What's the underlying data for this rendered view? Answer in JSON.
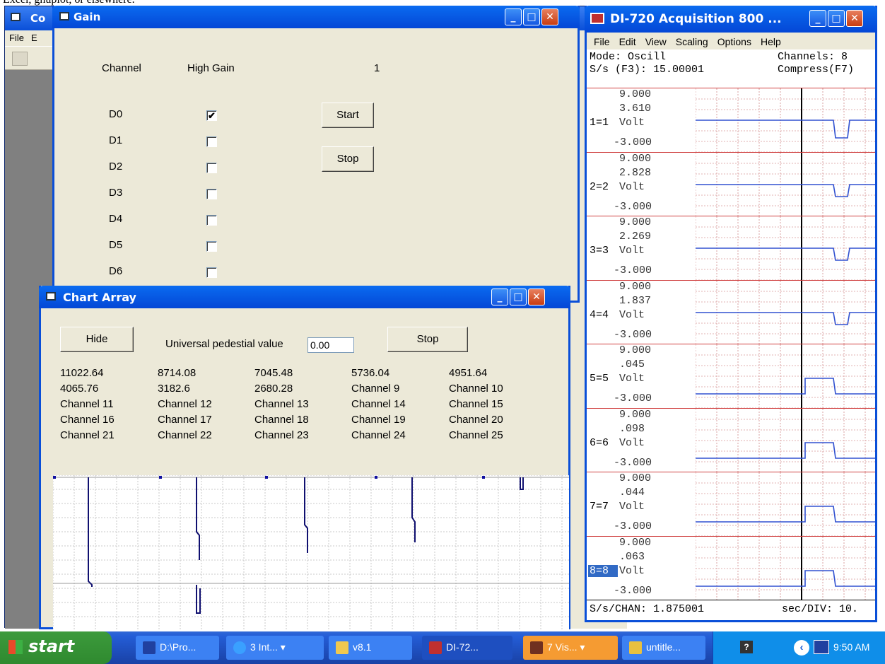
{
  "top_text": "Excel, gnuplot, or elsewhere.",
  "bg_window": {
    "title": "Co",
    "menu": [
      "File",
      "E"
    ]
  },
  "gain": {
    "title": "Gain",
    "header": {
      "channel": "Channel",
      "high_gain": "High Gain",
      "value": "1"
    },
    "channels": [
      {
        "label": "D0",
        "checked": true
      },
      {
        "label": "D1",
        "checked": false
      },
      {
        "label": "D2",
        "checked": false
      },
      {
        "label": "D3",
        "checked": false
      },
      {
        "label": "D4",
        "checked": false
      },
      {
        "label": "D5",
        "checked": false
      },
      {
        "label": "D6",
        "checked": false
      }
    ],
    "start_label": "Start",
    "stop_label": "Stop"
  },
  "chart_array": {
    "title": "Chart Array",
    "hide_label": "Hide",
    "pedestal_label": "Universal pedestial value",
    "pedestal_value": "0.00",
    "stop_label": "Stop",
    "cells": [
      [
        "11022.64",
        "8714.08",
        "7045.48",
        "5736.04",
        "4951.64"
      ],
      [
        "4065.76",
        "3182.6",
        "2680.28",
        "Channel 9",
        "Channel 10"
      ],
      [
        "Channel 11",
        "Channel 12",
        "Channel 13",
        "Channel 14",
        "Channel 15"
      ],
      [
        "Channel 16",
        "Channel 17",
        "Channel 18",
        "Channel 19",
        "Channel 20"
      ],
      [
        "Channel 21",
        "Channel 22",
        "Channel 23",
        "Channel 24",
        "Channel 25"
      ]
    ]
  },
  "di720": {
    "title": "DI-720 Acquisition 800 ...",
    "menu": [
      "File",
      "Edit",
      "View",
      "Scaling",
      "Options",
      "Help"
    ],
    "mode": "Mode: Oscill",
    "channels": "Channels: 8",
    "rate": "S/s (F3): 15.00001",
    "compress": "Compress(F7)",
    "traces": [
      {
        "top": "9.000",
        "value": "3.610",
        "label": "1=1",
        "unit": "Volt",
        "bottom": "-3.000"
      },
      {
        "top": "9.000",
        "value": "2.828",
        "label": "2=2",
        "unit": "Volt",
        "bottom": "-3.000"
      },
      {
        "top": "9.000",
        "value": "2.269",
        "label": "3=3",
        "unit": "Volt",
        "bottom": "-3.000"
      },
      {
        "top": "9.000",
        "value": "1.837",
        "label": "4=4",
        "unit": "Volt",
        "bottom": "-3.000"
      },
      {
        "top": "9.000",
        "value": ".045",
        "label": "5=5",
        "unit": "Volt",
        "bottom": "-3.000"
      },
      {
        "top": "9.000",
        "value": ".098",
        "label": "6=6",
        "unit": "Volt",
        "bottom": "-3.000"
      },
      {
        "top": "9.000",
        "value": ".044",
        "label": "7=7",
        "unit": "Volt",
        "bottom": "-3.000"
      },
      {
        "top": "9.000",
        "value": ".063",
        "label": "8=8",
        "unit": "Volt",
        "bottom": "-3.000"
      }
    ],
    "footer_left": "S/s/CHAN: 1.875001",
    "footer_right": "sec/DIV: 10."
  },
  "taskbar": {
    "start": "start",
    "items": [
      "D:\\Pro...",
      "3 Int...",
      "v8.1",
      "DI-72...",
      "7 Vis...",
      "untitle..."
    ],
    "clock": "9:50 AM"
  },
  "colors": {
    "title_blue": "#0a4fd8",
    "trace": "#3050d0",
    "grid_red": "#d04040",
    "plot_line": "#101070"
  }
}
